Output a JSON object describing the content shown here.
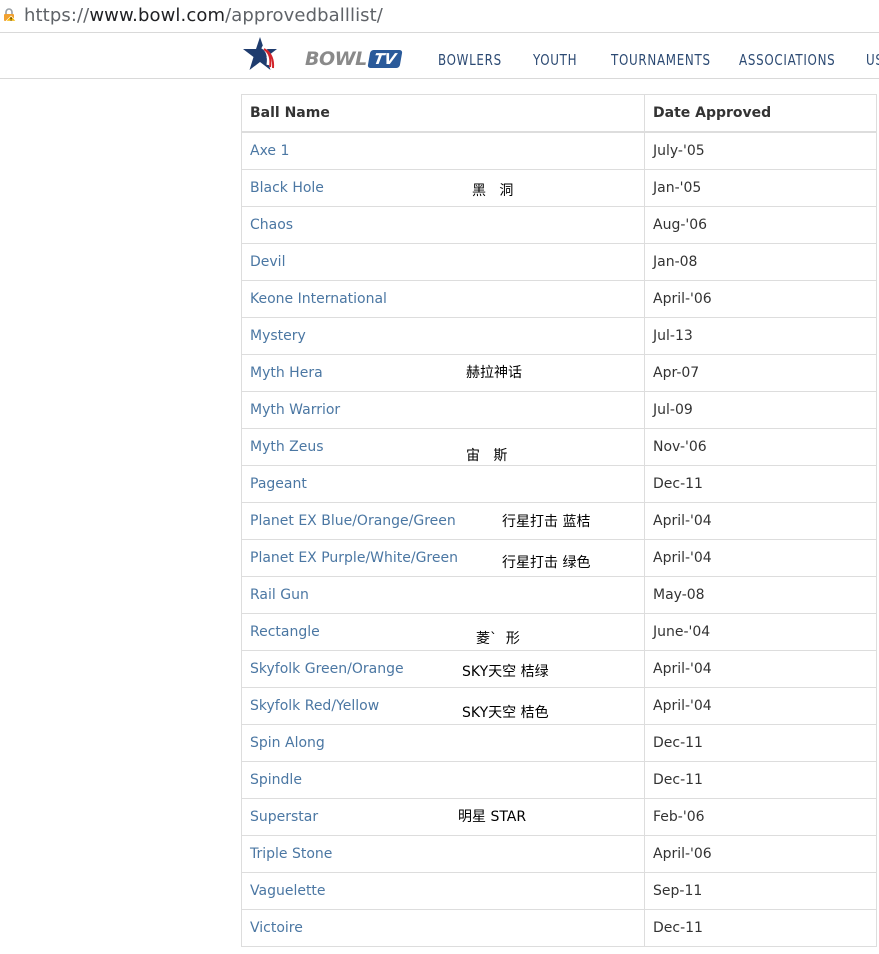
{
  "browser": {
    "url_prefix": "https://",
    "url_host": "www.bowl.com",
    "url_path": "/approvedballlist/"
  },
  "nav": {
    "logo_bowl": "BOWL",
    "logo_tv": "TV",
    "items": [
      {
        "label": "BOWLERS"
      },
      {
        "label": "YOUTH"
      },
      {
        "label": "TOURNAMENTS"
      },
      {
        "label": "ASSOCIATIONS"
      },
      {
        "label": "US"
      }
    ]
  },
  "table": {
    "headers": {
      "name": "Ball Name",
      "date": "Date Approved"
    },
    "rows": [
      {
        "name": "Axe 1",
        "date": "July-'05",
        "note": ""
      },
      {
        "name": "Black Hole",
        "date": "Jan-'05",
        "note": "黑   洞"
      },
      {
        "name": "Chaos",
        "date": "Aug-'06",
        "note": ""
      },
      {
        "name": "Devil",
        "date": "Jan-08",
        "note": ""
      },
      {
        "name": "Keone International",
        "date": "April-'06",
        "note": ""
      },
      {
        "name": "Mystery",
        "date": "Jul-13",
        "note": ""
      },
      {
        "name": "Myth Hera",
        "date": "Apr-07",
        "note": "赫拉神话"
      },
      {
        "name": "Myth Warrior",
        "date": "Jul-09",
        "note": ""
      },
      {
        "name": "Myth Zeus",
        "date": "Nov-'06",
        "note": "宙   斯"
      },
      {
        "name": "Pageant",
        "date": "Dec-11",
        "note": ""
      },
      {
        "name": "Planet EX Blue/Orange/Green",
        "date": "April-'04",
        "note": "行星打击 蓝桔"
      },
      {
        "name": "Planet EX Purple/White/Green",
        "date": "April-'04",
        "note": "行星打击 绿色"
      },
      {
        "name": "Rail Gun",
        "date": "May-08",
        "note": ""
      },
      {
        "name": "Rectangle",
        "date": "June-'04",
        "note": "菱`  形"
      },
      {
        "name": "Skyfolk Green/Orange",
        "date": "April-'04",
        "note": "SKY天空 桔绿"
      },
      {
        "name": "Skyfolk Red/Yellow",
        "date": "April-'04",
        "note": "SKY天空 桔色"
      },
      {
        "name": "Spin Along",
        "date": "Dec-11",
        "note": ""
      },
      {
        "name": "Spindle",
        "date": "Dec-11",
        "note": ""
      },
      {
        "name": "Superstar",
        "date": "Feb-'06",
        "note": "明星 STAR"
      },
      {
        "name": "Triple Stone",
        "date": "April-'06",
        "note": ""
      },
      {
        "name": "Vaguelette",
        "date": "Sep-11",
        "note": ""
      },
      {
        "name": "Victoire",
        "date": "Dec-11",
        "note": ""
      }
    ]
  },
  "colors": {
    "link": "#4b77a3",
    "nav": "#2c4a73",
    "border": "#dddddd"
  }
}
